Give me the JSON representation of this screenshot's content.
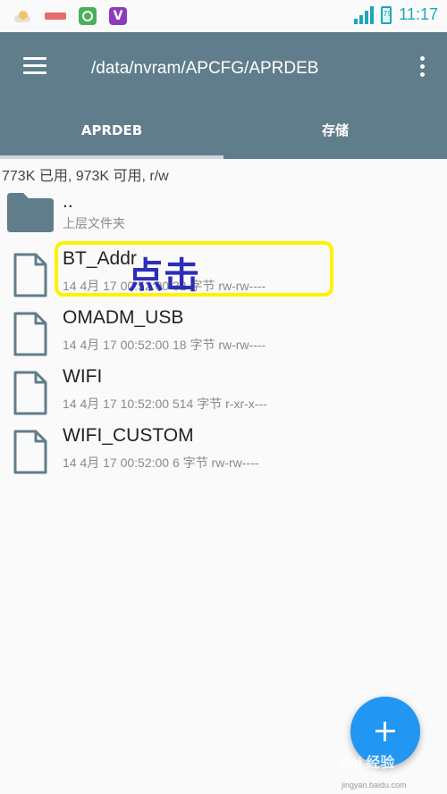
{
  "status_bar": {
    "battery": "79",
    "time": "11:17",
    "colors": {
      "accent": "#1aa7b8"
    }
  },
  "toolbar": {
    "title": "/data/nvram/APCFG/APRDEB",
    "menu_icon": "hamburger-menu-icon",
    "more_icon": "more-vertical-icon",
    "background": "#607d8b"
  },
  "tabs": [
    {
      "label": "APRDEB",
      "active": true
    },
    {
      "label": "存储",
      "active": false
    }
  ],
  "storage_info": "773K 已用, 973K 可用, r/w",
  "parent_folder": {
    "name": "..",
    "subtitle": "上层文件夹"
  },
  "files": [
    {
      "name": "BT_Addr",
      "meta": "14 4月 17 00:52:00 32 字节  rw-rw----"
    },
    {
      "name": "OMADM_USB",
      "meta": "14 4月 17 00:52:00 18 字节  rw-rw----"
    },
    {
      "name": "WIFI",
      "meta": "14 4月 17 10:52:00 514 字节  r-xr-x---"
    },
    {
      "name": "WIFI_CUSTOM",
      "meta": "14 4月 17 00:52:00 6 字节  rw-rw----"
    }
  ],
  "annotation": "点击",
  "fab": {
    "icon": "add-icon",
    "color": "#2196f3"
  },
  "watermark": {
    "text": "Bai 经验",
    "sub": "jingyan.baidu.com"
  }
}
